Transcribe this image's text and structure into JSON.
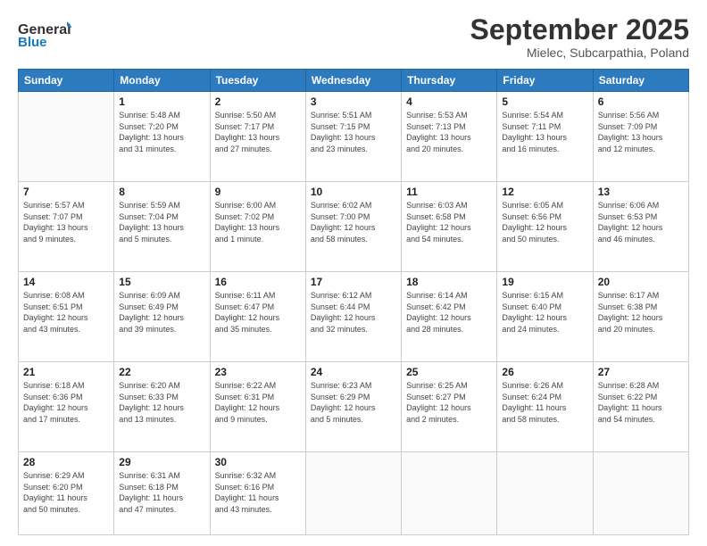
{
  "header": {
    "logo_line1": "General",
    "logo_line2": "Blue",
    "month": "September 2025",
    "location": "Mielec, Subcarpathia, Poland"
  },
  "weekdays": [
    "Sunday",
    "Monday",
    "Tuesday",
    "Wednesday",
    "Thursday",
    "Friday",
    "Saturday"
  ],
  "weeks": [
    [
      {
        "day": "",
        "info": ""
      },
      {
        "day": "1",
        "info": "Sunrise: 5:48 AM\nSunset: 7:20 PM\nDaylight: 13 hours\nand 31 minutes."
      },
      {
        "day": "2",
        "info": "Sunrise: 5:50 AM\nSunset: 7:17 PM\nDaylight: 13 hours\nand 27 minutes."
      },
      {
        "day": "3",
        "info": "Sunrise: 5:51 AM\nSunset: 7:15 PM\nDaylight: 13 hours\nand 23 minutes."
      },
      {
        "day": "4",
        "info": "Sunrise: 5:53 AM\nSunset: 7:13 PM\nDaylight: 13 hours\nand 20 minutes."
      },
      {
        "day": "5",
        "info": "Sunrise: 5:54 AM\nSunset: 7:11 PM\nDaylight: 13 hours\nand 16 minutes."
      },
      {
        "day": "6",
        "info": "Sunrise: 5:56 AM\nSunset: 7:09 PM\nDaylight: 13 hours\nand 12 minutes."
      }
    ],
    [
      {
        "day": "7",
        "info": "Sunrise: 5:57 AM\nSunset: 7:07 PM\nDaylight: 13 hours\nand 9 minutes."
      },
      {
        "day": "8",
        "info": "Sunrise: 5:59 AM\nSunset: 7:04 PM\nDaylight: 13 hours\nand 5 minutes."
      },
      {
        "day": "9",
        "info": "Sunrise: 6:00 AM\nSunset: 7:02 PM\nDaylight: 13 hours\nand 1 minute."
      },
      {
        "day": "10",
        "info": "Sunrise: 6:02 AM\nSunset: 7:00 PM\nDaylight: 12 hours\nand 58 minutes."
      },
      {
        "day": "11",
        "info": "Sunrise: 6:03 AM\nSunset: 6:58 PM\nDaylight: 12 hours\nand 54 minutes."
      },
      {
        "day": "12",
        "info": "Sunrise: 6:05 AM\nSunset: 6:56 PM\nDaylight: 12 hours\nand 50 minutes."
      },
      {
        "day": "13",
        "info": "Sunrise: 6:06 AM\nSunset: 6:53 PM\nDaylight: 12 hours\nand 46 minutes."
      }
    ],
    [
      {
        "day": "14",
        "info": "Sunrise: 6:08 AM\nSunset: 6:51 PM\nDaylight: 12 hours\nand 43 minutes."
      },
      {
        "day": "15",
        "info": "Sunrise: 6:09 AM\nSunset: 6:49 PM\nDaylight: 12 hours\nand 39 minutes."
      },
      {
        "day": "16",
        "info": "Sunrise: 6:11 AM\nSunset: 6:47 PM\nDaylight: 12 hours\nand 35 minutes."
      },
      {
        "day": "17",
        "info": "Sunrise: 6:12 AM\nSunset: 6:44 PM\nDaylight: 12 hours\nand 32 minutes."
      },
      {
        "day": "18",
        "info": "Sunrise: 6:14 AM\nSunset: 6:42 PM\nDaylight: 12 hours\nand 28 minutes."
      },
      {
        "day": "19",
        "info": "Sunrise: 6:15 AM\nSunset: 6:40 PM\nDaylight: 12 hours\nand 24 minutes."
      },
      {
        "day": "20",
        "info": "Sunrise: 6:17 AM\nSunset: 6:38 PM\nDaylight: 12 hours\nand 20 minutes."
      }
    ],
    [
      {
        "day": "21",
        "info": "Sunrise: 6:18 AM\nSunset: 6:36 PM\nDaylight: 12 hours\nand 17 minutes."
      },
      {
        "day": "22",
        "info": "Sunrise: 6:20 AM\nSunset: 6:33 PM\nDaylight: 12 hours\nand 13 minutes."
      },
      {
        "day": "23",
        "info": "Sunrise: 6:22 AM\nSunset: 6:31 PM\nDaylight: 12 hours\nand 9 minutes."
      },
      {
        "day": "24",
        "info": "Sunrise: 6:23 AM\nSunset: 6:29 PM\nDaylight: 12 hours\nand 5 minutes."
      },
      {
        "day": "25",
        "info": "Sunrise: 6:25 AM\nSunset: 6:27 PM\nDaylight: 12 hours\nand 2 minutes."
      },
      {
        "day": "26",
        "info": "Sunrise: 6:26 AM\nSunset: 6:24 PM\nDaylight: 11 hours\nand 58 minutes."
      },
      {
        "day": "27",
        "info": "Sunrise: 6:28 AM\nSunset: 6:22 PM\nDaylight: 11 hours\nand 54 minutes."
      }
    ],
    [
      {
        "day": "28",
        "info": "Sunrise: 6:29 AM\nSunset: 6:20 PM\nDaylight: 11 hours\nand 50 minutes."
      },
      {
        "day": "29",
        "info": "Sunrise: 6:31 AM\nSunset: 6:18 PM\nDaylight: 11 hours\nand 47 minutes."
      },
      {
        "day": "30",
        "info": "Sunrise: 6:32 AM\nSunset: 6:16 PM\nDaylight: 11 hours\nand 43 minutes."
      },
      {
        "day": "",
        "info": ""
      },
      {
        "day": "",
        "info": ""
      },
      {
        "day": "",
        "info": ""
      },
      {
        "day": "",
        "info": ""
      }
    ]
  ]
}
